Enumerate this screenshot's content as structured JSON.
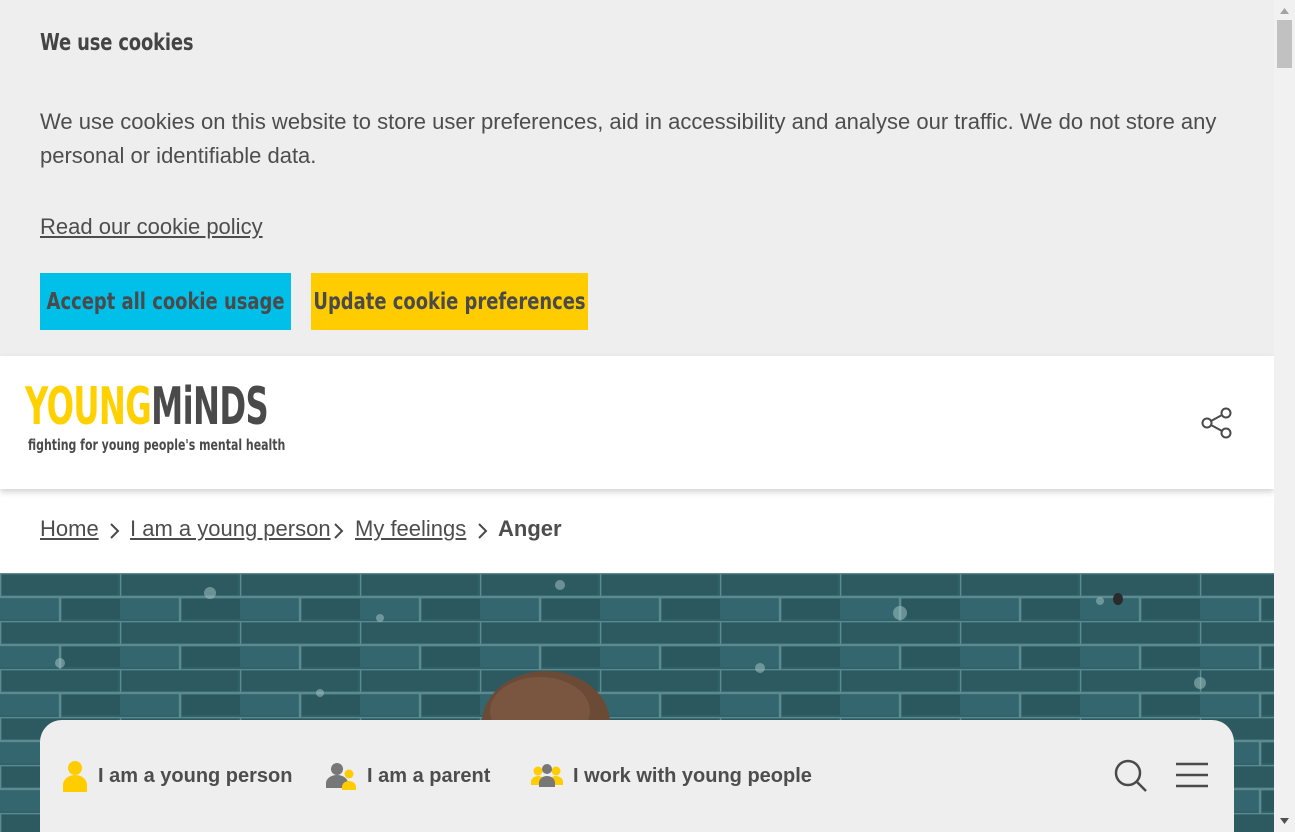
{
  "cookie_banner": {
    "title": "We use cookies",
    "message": "We use cookies on this website to store user preferences, aid in accessibility and analyse our traffic. We do not store any personal or identifiable data.",
    "policy_link": "Read our cookie policy",
    "accept_button": "Accept all cookie usage",
    "update_button": "Update cookie preferences"
  },
  "header": {
    "logo_part1": "YOUNG",
    "logo_part2": "MiNDS",
    "logo_tagline": "fighting for young people's mental health",
    "share_icon": "share-icon"
  },
  "breadcrumb": {
    "items": [
      "Home",
      "I am a young person",
      "My feelings"
    ],
    "current": "Anger"
  },
  "audience_nav": {
    "items": [
      "I am a young person",
      "I am a parent",
      "I work with young people"
    ],
    "icons": [
      "person-icon",
      "parent-icon",
      "group-icon"
    ],
    "search_icon": "search-icon",
    "menu_icon": "menu-icon"
  },
  "colors": {
    "accent_blue": "#00bfe8",
    "accent_yellow": "#ffcc00",
    "logo_yellow": "#ffd100",
    "text_grey": "#4a4a4a",
    "banner_bg": "#eeeeee"
  }
}
